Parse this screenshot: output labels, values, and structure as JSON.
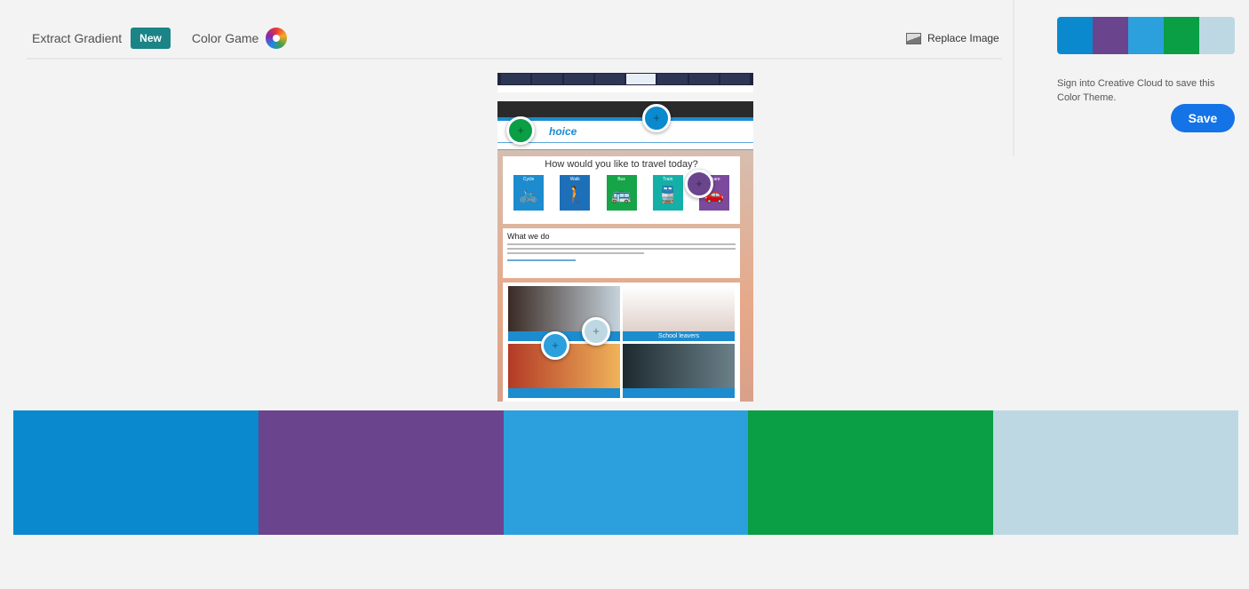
{
  "header": {
    "extract_gradient": "Extract Gradient",
    "new_badge": "New",
    "color_game": "Color Game",
    "replace_image": "Replace Image"
  },
  "panel": {
    "signin_text": "Sign into Creative Cloud to save this Color Theme.",
    "save_label": "Save"
  },
  "theme_colors": [
    "#0A89CE",
    "#6A448D",
    "#2CA0DC",
    "#0A9E45",
    "#BDD8E3"
  ],
  "source_image": {
    "brand": "hoice",
    "headline": "How would you like to travel today?",
    "modes": [
      {
        "label": "Cycle",
        "color": "#1c8ccf"
      },
      {
        "label": "Walk",
        "color": "#1d6fb8"
      },
      {
        "label": "Bus",
        "color": "#15a447"
      },
      {
        "label": "Train",
        "color": "#14b0a8"
      },
      {
        "label": "Share",
        "color": "#7b4a9c"
      }
    ],
    "section_title": "What we do",
    "tiles": [
      "",
      "School leavers",
      "",
      ""
    ]
  },
  "icons": {
    "color_game": "color-wheel-icon",
    "replace_image": "image-icon",
    "picker": "plus-icon"
  }
}
